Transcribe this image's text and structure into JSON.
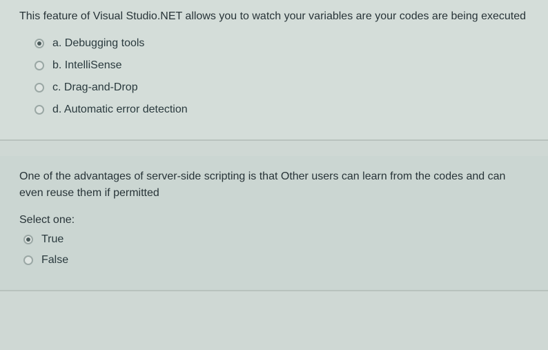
{
  "question1": {
    "text": "This feature of Visual Studio.NET allows you to watch your variables are your codes are being executed",
    "options": [
      {
        "label": "a. Debugging tools",
        "selected": true
      },
      {
        "label": "b. IntelliSense",
        "selected": false
      },
      {
        "label": "c. Drag-and-Drop",
        "selected": false
      },
      {
        "label": "d. Automatic error detection",
        "selected": false
      }
    ]
  },
  "question2": {
    "text": "One of the advantages of server-side scripting is that Other users can learn from the codes and can even reuse them if permitted",
    "select_label": "Select one:",
    "options": [
      {
        "label": "True",
        "selected": true
      },
      {
        "label": "False",
        "selected": false
      }
    ]
  }
}
